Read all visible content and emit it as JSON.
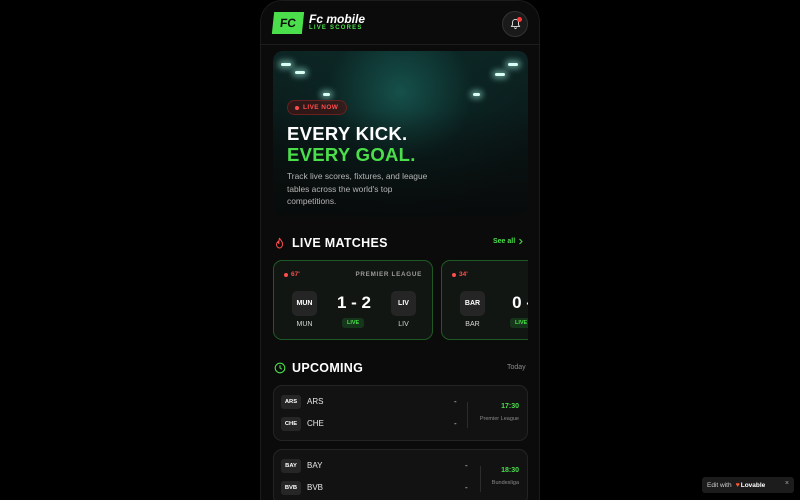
{
  "header": {
    "logo": "FC",
    "title": "Fc mobile",
    "subtitle": "LIVE SCORES",
    "bell_icon": "bell-icon"
  },
  "hero": {
    "pill": "LIVE NOW",
    "line1": "EVERY KICK.",
    "line2": "EVERY GOAL.",
    "description": "Track live scores, fixtures, and league tables across the world's top competitions."
  },
  "live_section": {
    "title": "LIVE MATCHES",
    "see_all": "See all",
    "icon": "flame-icon",
    "matches": [
      {
        "minute": "67'",
        "league": "PREMIER LEAGUE",
        "home": "MUN",
        "away": "LIV",
        "score": "1 - 2",
        "status": "LIVE"
      },
      {
        "minute": "34'",
        "league": "",
        "home": "BAR",
        "away": "",
        "score": "0 -",
        "status": "LIVE"
      }
    ]
  },
  "upcoming_section": {
    "title": "UPCOMING",
    "filter": "Today",
    "icon": "clock-icon",
    "matches": [
      {
        "home": "ARS",
        "away": "CHE",
        "home_score": "-",
        "away_score": "-",
        "time": "17:30",
        "league": "Premier League"
      },
      {
        "home": "BAY",
        "away": "BVB",
        "home_score": "-",
        "away_score": "-",
        "time": "18:30",
        "league": "Bundesliga"
      }
    ]
  },
  "footer_badge": {
    "prefix": "Edit with",
    "brand": "Lovable",
    "close": "×"
  },
  "colors": {
    "accent": "#4be04b",
    "live_red": "#ff4d4d",
    "background": "#0b0b0b"
  }
}
